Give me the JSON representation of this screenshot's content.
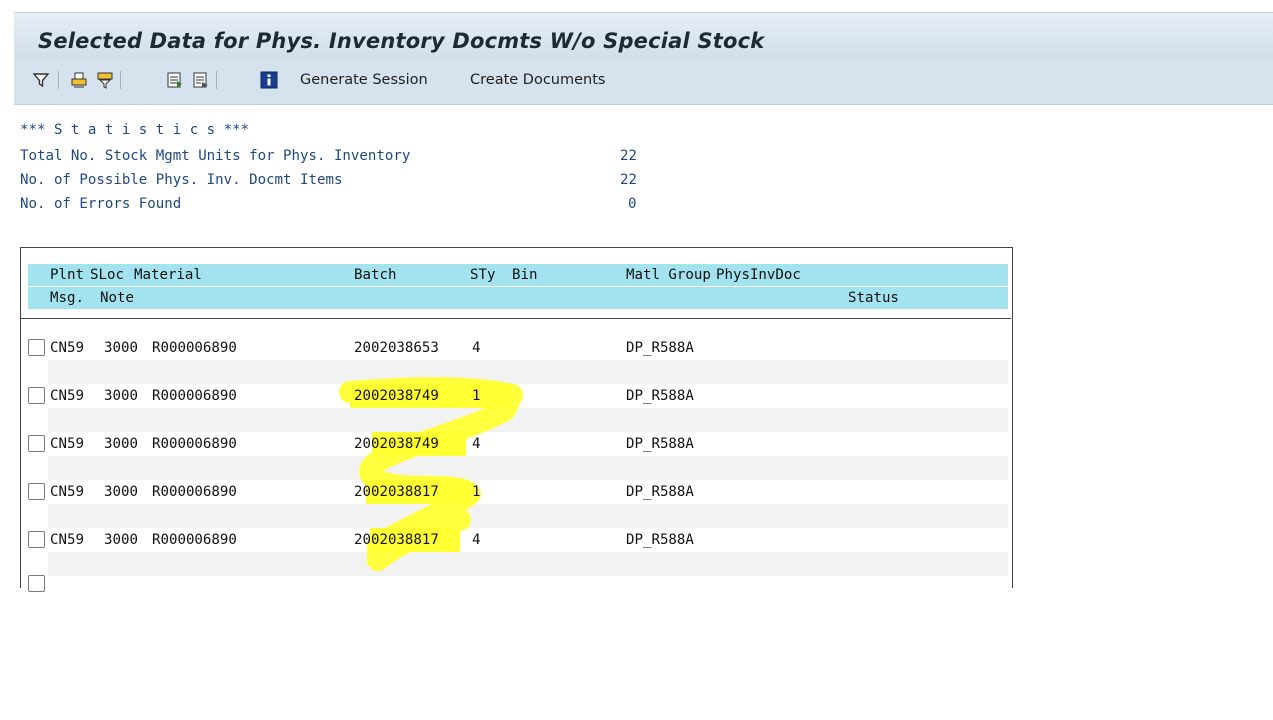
{
  "window": {
    "title": "Selected Data for Phys. Inventory Docmts W/o Special Stock"
  },
  "toolbar": {
    "icons": [
      "filter-icon",
      "print-icon",
      "print-filter-icon",
      "export-icon",
      "export-list-icon",
      "info-icon"
    ],
    "generate_session": "Generate Session",
    "create_documents": "Create Documents"
  },
  "statistics": {
    "heading": "*** S t a t i s t i c s ***",
    "lines": [
      {
        "label": "Total No. Stock Mgmt Units for Phys. Inventory",
        "value": "22"
      },
      {
        "label": "No. of Possible Phys. Inv. Docmt Items",
        "value": "22"
      },
      {
        "label": "No. of Errors Found",
        "value": "0"
      }
    ]
  },
  "table": {
    "header1": {
      "plnt": "Plnt",
      "sloc": "SLoc",
      "material": "Material",
      "batch": "Batch",
      "sty": "STy",
      "bin": "Bin",
      "matl_group": "Matl Group",
      "physinvdoc": "PhysInvDoc"
    },
    "header2": {
      "msg": "Msg.",
      "note": "Note",
      "status": "Status"
    },
    "rows": [
      {
        "plnt": "CN59",
        "sloc": "3000",
        "material": "R000006890",
        "batch": "2002038653",
        "sty": "4",
        "matl_group": "DP_R588A"
      },
      {
        "plnt": "CN59",
        "sloc": "3000",
        "material": "R000006890",
        "batch": "2002038749",
        "sty": "1",
        "matl_group": "DP_R588A"
      },
      {
        "plnt": "CN59",
        "sloc": "3000",
        "material": "R000006890",
        "batch": "2002038749",
        "sty": "4",
        "matl_group": "DP_R588A"
      },
      {
        "plnt": "CN59",
        "sloc": "3000",
        "material": "R000006890",
        "batch": "2002038817",
        "sty": "1",
        "matl_group": "DP_R588A"
      },
      {
        "plnt": "CN59",
        "sloc": "3000",
        "material": "R000006890",
        "batch": "2002038817",
        "sty": "4",
        "matl_group": "DP_R588A"
      }
    ]
  },
  "colors": {
    "highlight": "#ffff33",
    "header_bg": "#a3e3f0",
    "stat_text": "#1f4880"
  }
}
